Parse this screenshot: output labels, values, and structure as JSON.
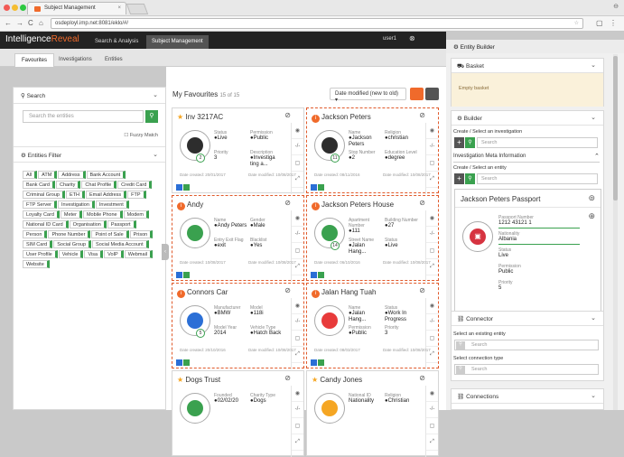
{
  "browser": {
    "tab_title": "Subject Management",
    "url": "osdeployl.imp.net:8081/eklo/#/"
  },
  "header": {
    "logo_a": "Intelligence",
    "logo_b": "Reveal",
    "tabs": [
      "Search & Analysis",
      "Subject Management"
    ],
    "user": "user1",
    "entity_builder": "Entity Builder"
  },
  "subtabs": [
    "Favourites",
    "Investigations",
    "Entities"
  ],
  "left": {
    "search_title": "Search",
    "search_placeholder": "Search the entities",
    "fuzzy": "Fuzzy Match",
    "filter_title": "Entities Filter",
    "chips": [
      "All",
      "ATM",
      "Address",
      "Bank Account",
      "Bank Card",
      "Charity",
      "Chat Profile",
      "Credit Card",
      "Criminal Group",
      "ETH",
      "Email Address",
      "FTP",
      "FTP Server",
      "Investigation",
      "Investment",
      "Loyalty Card",
      "Meter",
      "Mobile Phone",
      "Modem",
      "National ID Card",
      "Organisation",
      "Passport",
      "Person",
      "Phone Number",
      "Point of Sale",
      "Prison",
      "SIM Card",
      "Social Group",
      "Social Media Account",
      "User Profile",
      "Vehicle",
      "Visa",
      "VoIP",
      "Webmail",
      "Website"
    ]
  },
  "main": {
    "title": "My Favourites",
    "count": "15 of 15",
    "sort": "Date modified (new to old)"
  },
  "cards": [
    {
      "title": "Inv 3217AC",
      "kind": "star",
      "sel": false,
      "count": "2",
      "f": [
        [
          "Status",
          "●Live"
        ],
        [
          "Permission",
          "●Public"
        ],
        [
          "Priority",
          "3"
        ],
        [
          "Description",
          "●Investiga ting a..."
        ]
      ],
      "c": "Date created: 20/01/2017",
      "m": "Date modified: 10/08/2017"
    },
    {
      "title": "Jackson Peters",
      "kind": "i",
      "sel": true,
      "count": "11",
      "f": [
        [
          "Name",
          "●Jackson Peters"
        ],
        [
          "Religion",
          "●christian"
        ],
        [
          "Stop Number",
          "●2"
        ],
        [
          "Education Level",
          "●degree"
        ]
      ],
      "c": "Date created: 08/11/2016",
      "m": "Date modified: 10/08/2017"
    },
    {
      "title": "Andy",
      "kind": "i",
      "sel": true,
      "count": "",
      "f": [
        [
          "Name",
          "●Andy Peters"
        ],
        [
          "Gender",
          "●Male"
        ],
        [
          "Entry Exit Flag",
          "●exit"
        ],
        [
          "Blacklist",
          "●Yes"
        ]
      ],
      "c": "Date created: 10/08/2017",
      "m": "Date modified: 10/08/2017"
    },
    {
      "title": "Jackson Peters House",
      "kind": "i",
      "sel": true,
      "count": "14",
      "f": [
        [
          "Apartment Number",
          "●111"
        ],
        [
          "Building Number",
          "●27"
        ],
        [
          "Street Name",
          "●Jalan Hang..."
        ],
        [
          "Status",
          "●Live"
        ]
      ],
      "c": "Date created: 06/10/2016",
      "m": "Date modified: 10/08/2017"
    },
    {
      "title": "Connors Car",
      "kind": "i",
      "sel": true,
      "count": "5",
      "f": [
        [
          "Manufacturer",
          "●BMW"
        ],
        [
          "Model",
          "●118i"
        ],
        [
          "Model Year",
          "2014"
        ],
        [
          "Vehicle Type",
          "●Hatch Back"
        ]
      ],
      "c": "Date created: 20/10/2016",
      "m": "Date modified: 10/08/2017"
    },
    {
      "title": "Jalan Hang Tuah",
      "kind": "i",
      "sel": true,
      "count": "",
      "f": [
        [
          "Name",
          "●Jalan Hang..."
        ],
        [
          "Status",
          "●Work In Progress"
        ],
        [
          "Permission",
          "●Public"
        ],
        [
          "Priority",
          "3"
        ]
      ],
      "c": "Date created: 08/03/2017",
      "m": "Date modified: 10/08/2017"
    },
    {
      "title": "Dogs Trust",
      "kind": "star",
      "sel": false,
      "count": "",
      "f": [
        [
          "Founded",
          "●02/02/20"
        ],
        [
          "Charity Type",
          "●Dogs"
        ]
      ],
      "c": "",
      "m": ""
    },
    {
      "title": "Candy Jones",
      "kind": "star",
      "sel": false,
      "count": "",
      "f": [
        [
          "National ID",
          "Nationality"
        ],
        [
          "Religion",
          "●Christian"
        ]
      ],
      "c": "",
      "m": ""
    }
  ],
  "right": {
    "basket": "Basket",
    "empty_basket": "Empty basket",
    "builder": "Builder",
    "create_inv": "Create / Select an investigation",
    "search": "Search",
    "inv_meta": "Investigation Meta Information",
    "create_ent": "Create / Select an entity",
    "passport_title": "Jackson Peters Passport",
    "pf": [
      [
        "Passport Number",
        "1212 43121 1"
      ],
      [
        "Nationality",
        "Albania"
      ],
      [
        "Status",
        "Live"
      ],
      [
        "Permission",
        "Public"
      ],
      [
        "Priority",
        "5"
      ]
    ],
    "connector": "Connector",
    "select_entity": "Select an existing entity",
    "select_conn": "Select connection type",
    "connections": "Connections"
  },
  "colors": {
    "accent": "#f06a2b",
    "green": "#3aa14f",
    "dark": "#232323"
  }
}
